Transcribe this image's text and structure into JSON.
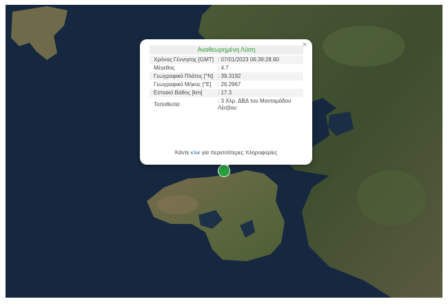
{
  "popup": {
    "title": "Αναθεωρημένη Λύση",
    "rows": [
      {
        "label": "Χρόνος Γέννησης [GMT]",
        "value": ": 07/01/2023 06:39:28.60"
      },
      {
        "label": "Μέγεθος",
        "value": ": 4.7"
      },
      {
        "label": "Γεωγραφικό Πλάτος [°N]",
        "value": ": 39.3192"
      },
      {
        "label": "Γεωγραφικό Μήκος [°E]",
        "value": ": 26.2967"
      },
      {
        "label": "Εστιακό Βάθος [km]",
        "value": ": 17.3"
      },
      {
        "label": "Τοποθεσία",
        "value": ": 3 Χλμ. ΔΒΔ του Μανταμάδου Λέσβου"
      }
    ],
    "footer_before": "Κάντε ",
    "footer_link": "κλικ",
    "footer_after": " για περισσότερες πληροφορίες",
    "close_glyph": "×"
  },
  "colors": {
    "sea": "#16283f",
    "marker": "#2a9f3e",
    "title_text": "#2e9c32",
    "link": "#2a7ab8"
  },
  "icons": {
    "close": "close-icon",
    "marker": "epicenter-marker-icon"
  }
}
